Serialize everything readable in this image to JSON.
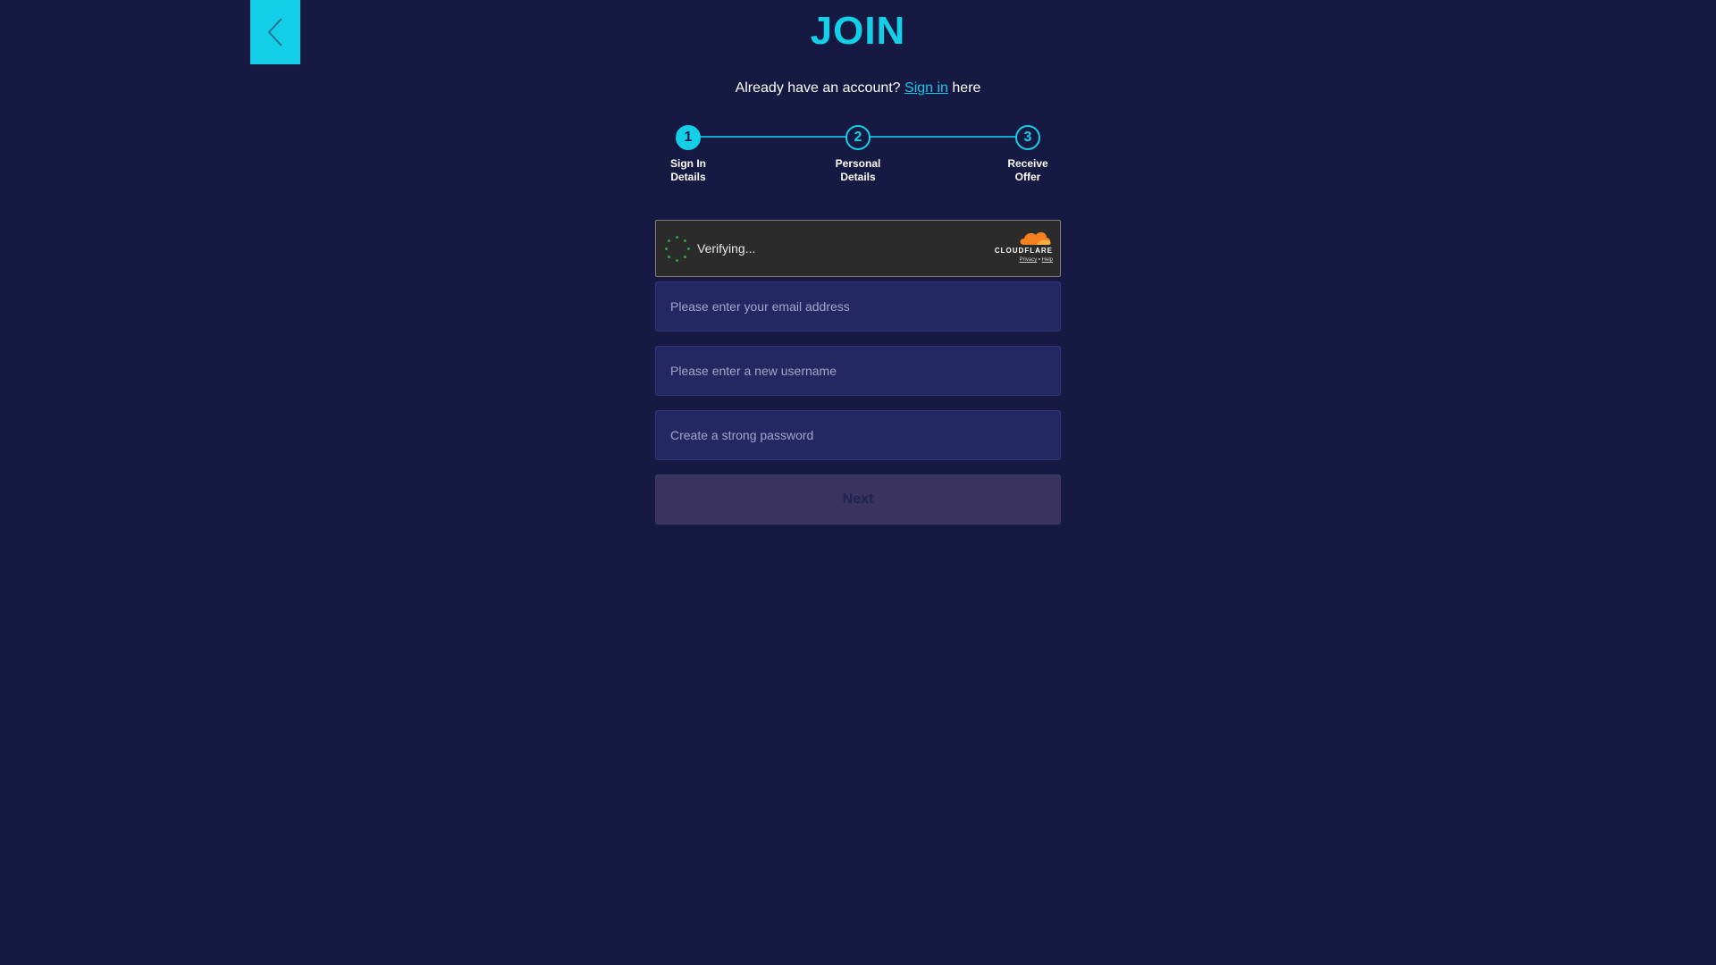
{
  "header": {
    "title": "JOIN",
    "back_icon": "chevron-left-icon"
  },
  "signin": {
    "prefix": "Already have an account?",
    "link": "Sign in",
    "suffix": "here"
  },
  "stepper": {
    "steps": [
      {
        "number": "1",
        "label": "Sign In\nDetails",
        "active": true
      },
      {
        "number": "2",
        "label": "Personal\nDetails",
        "active": false
      },
      {
        "number": "3",
        "label": "Receive\nOffer",
        "active": false
      }
    ]
  },
  "captcha": {
    "status": "Verifying...",
    "brand": "CLOUDFLARE",
    "privacy": "Privacy",
    "separator": "•",
    "help": "Help"
  },
  "form": {
    "email_placeholder": "Please enter your email address",
    "username_placeholder": "Please enter a new username",
    "password_placeholder": "Create a strong password",
    "next_label": "Next"
  },
  "colors": {
    "background": "#161941",
    "accent": "#13d0e8",
    "input_bg": "#232762",
    "button_disabled": "#3a3360",
    "cloudflare_orange": "#f48120"
  }
}
